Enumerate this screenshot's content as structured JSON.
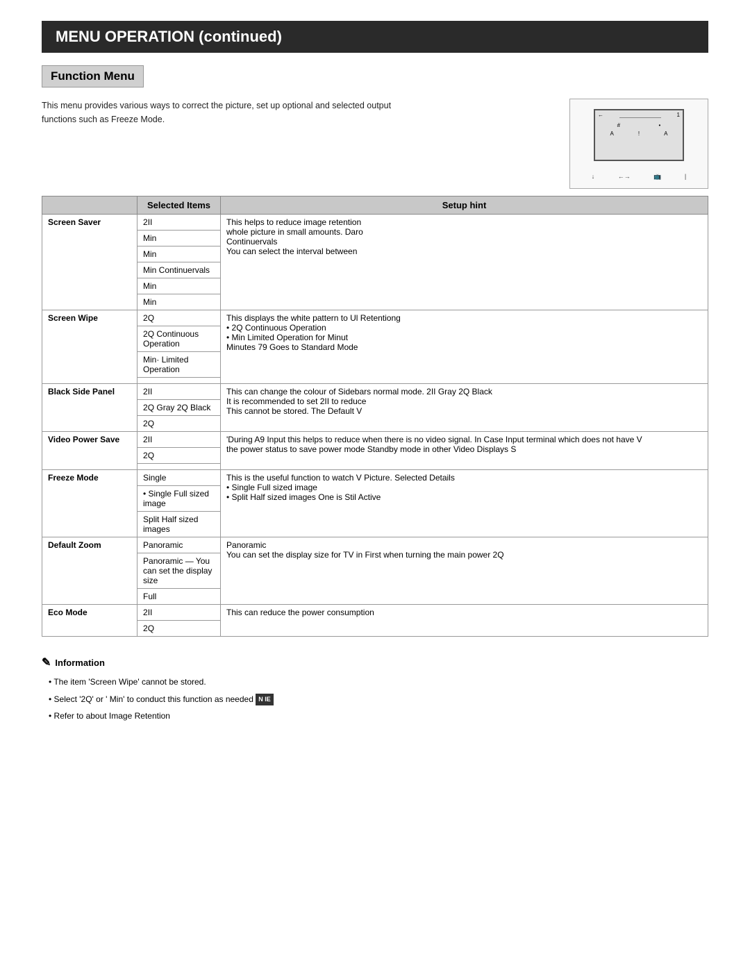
{
  "header": {
    "title": "MENU OPERATION (continued)"
  },
  "section": {
    "title": "Function Menu"
  },
  "intro": {
    "line1": "This menu provides various ways to correct the picture, set up optional and selected output",
    "line2": "functions such as Freeze Mode."
  },
  "table": {
    "col1": "Selected Items",
    "col2": "Setup hint",
    "rows": [
      {
        "label": "Screen Saver",
        "items": [
          "2II",
          "Min",
          "Min",
          "Min",
          "Min",
          "Min"
        ],
        "hints": [
          "This helps to reduce image retention",
          "whole picture in small amounts. Daro",
          "Continuervals",
          "You can select the interval between"
        ]
      },
      {
        "label": "Screen Wipe",
        "items": [
          "2Q",
          "2Q",
          "Min·",
          ""
        ],
        "hints": [
          "This displays the white pattern to Ul Retentiong",
          "• 2Q  Continuous Operation",
          "• Min  Limited Operation for  Minut",
          "Minutes 79 Goes to Standard Mode"
        ]
      },
      {
        "label": "Black Side Panel",
        "items": [
          "2II",
          "2Q"
        ],
        "hints": [
          "This can change the colour of Sidebars normal mode.  2II Gray  2Q Black",
          "It is recommended to set 2II to reduce",
          "This cannot be stored.  The Default V"
        ]
      },
      {
        "label": "Video Power Save",
        "items": [
          "2II",
          "2Q"
        ],
        "hints": [
          "'During A9 Input this helps to reduce when there is no video signal.  In Case Input terminal which does not have V",
          "the power status to save power mode  Standby mode in other Video Displays S"
        ]
      },
      {
        "label": "Freeze Mode",
        "items": [
          "Single",
          "Split"
        ],
        "hints": [
          "This is the useful function to watch V Picture.  Selected Details",
          "• Single  Full sized image",
          "• Split  Half sized images  One is Stil Active"
        ]
      },
      {
        "label": "Default Zoom",
        "items": [
          "Panoramic",
          "Panoramic",
          "Full"
        ],
        "hints": [
          "Panoramic",
          "You can set the display size for TV in First when turning the main power 2Q"
        ]
      },
      {
        "label": "Eco Mode",
        "items": [
          "2II",
          "2Q"
        ],
        "hints": [
          "This can reduce the power consumption"
        ]
      }
    ]
  },
  "notes": {
    "title": "Information",
    "icon": "✎",
    "items": [
      "The item 'Screen Wipe' cannot be stored.",
      "Select '2Q' or '  Min' to conduct this function as needed",
      "Refer to about Image Retention"
    ],
    "badge": "N IE"
  }
}
